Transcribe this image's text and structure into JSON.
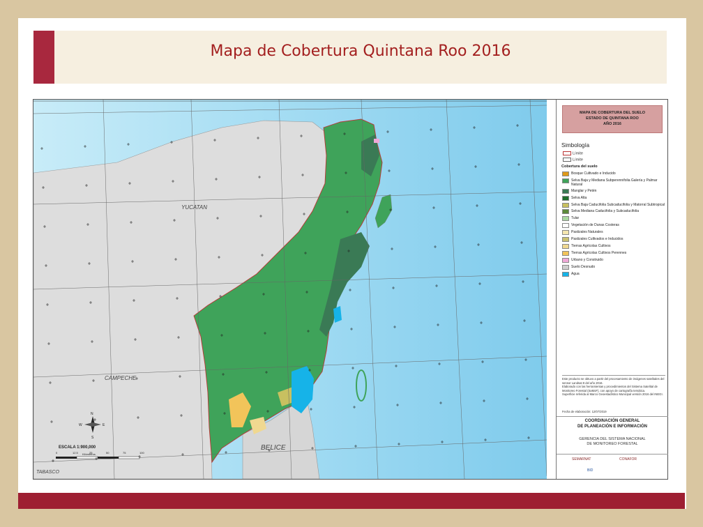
{
  "slide": {
    "title": "Mapa de Cobertura Quintana Roo 2016"
  },
  "map": {
    "labels": {
      "yucatan": "YUCATAN",
      "campeche": "CAMPECHE",
      "belice": "BELICE",
      "tabasco": "TABASCO"
    },
    "scale_text": "ESCALA  1:900,000",
    "scale_unit": "Kilómetros",
    "scale_ticks": [
      "0",
      "12.5",
      "25",
      "50",
      "75",
      "100"
    ],
    "compass": {
      "n": "N",
      "s": "S",
      "e": "E",
      "w": "W"
    }
  },
  "legend": {
    "title_lines": [
      "MAPA DE COBERTURA DEL SUELO",
      "ESTADO DE QUINTANA ROO",
      "AÑO 2016"
    ],
    "simbologia": "Simbología",
    "limite_1": "Límite",
    "limite_2": "Límite",
    "cobertura_heading": "Cobertura del suelo",
    "items": [
      {
        "label": "Bosque Cultivado e Inducido",
        "color": "#e09a1a"
      },
      {
        "label": "Selva Baja y Mediana Subperennifolia Galería y Palmar Natural",
        "color": "#3fa35a"
      },
      {
        "label": "Manglar y Petén",
        "color": "#3a7a55"
      },
      {
        "label": "Selva Alta",
        "color": "#1e6e2c"
      },
      {
        "label": "Selva Baja Caducifolia Subcaducifolia y Matorral Subtropical",
        "color": "#c8c060"
      },
      {
        "label": "Selva Mediana Caducifolia y Subcaducifolia",
        "color": "#5d8a3a"
      },
      {
        "label": "Tular",
        "color": "#a9d9a0"
      },
      {
        "label": "Vegetación de Dunas Costeras",
        "color": "#ffffff"
      },
      {
        "label": "Pastizales Naturales",
        "color": "#f5e6b0"
      },
      {
        "label": "Pastizales Cultivados e Inducidos",
        "color": "#c9c070"
      },
      {
        "label": "Tierras Agrícolas Cultivos",
        "color": "#f0d890"
      },
      {
        "label": "Tierras Agrícolas Cultivos Perennes",
        "color": "#f2c45a"
      },
      {
        "label": "Urbano y Construido",
        "color": "#f0a8d8"
      },
      {
        "label": "Suelo Desnudo",
        "color": "#cfcfcf"
      },
      {
        "label": "Agua",
        "color": "#16b3e8"
      }
    ],
    "notes": [
      "Este producto se obtuvo a partir del procesamiento de imágenes satelitales del sensor Landsat 8 del año 2016.",
      "Elaborado con las herramientas y procedimientos del Sistema Satelital de Monitoreo Forestal (SaMoF), con apoyo de cartografía temática.",
      "Superficie referida al Marco Geoestadístico Municipal versión 2016 del INEGI."
    ],
    "date_line": "Fecha de elaboración:   12/07/2019",
    "coord_lines": [
      "COORDINACIÓN GENERAL",
      "DE PLANEACIÓN E INFORMACIÓN"
    ],
    "gerencia_lines": [
      "GERENCIA DEL SISTEMA NACIONAL",
      "DE MONITOREO FORESTAL"
    ],
    "logos": {
      "semarnat": "SEMARNAT",
      "conafor": "CONAFOR",
      "bid": "BID"
    }
  },
  "colors": {
    "brand_red": "#a31f1f",
    "band_red": "#9e1f32",
    "beige": "#d9c6a1",
    "sea": "#8fd1ee",
    "land_neighbor": "#dddddd",
    "forest": "#3fa35a"
  }
}
